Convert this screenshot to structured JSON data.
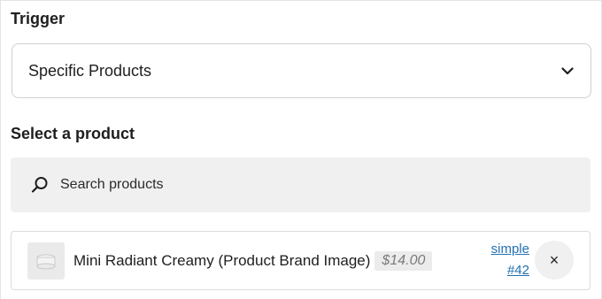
{
  "trigger": {
    "label": "Trigger",
    "selected": "Specific Products"
  },
  "product_select": {
    "label": "Select a product",
    "search_placeholder": "Search products"
  },
  "selected_product": {
    "name": "Mini Radiant Creamy (Product Brand Image)",
    "price": "$14.00",
    "type": "simple",
    "id": "#42",
    "remove_label": "×"
  },
  "icons": {
    "chevron": "chevron-down-icon",
    "search": "search-icon",
    "thumbnail": "product-thumbnail-icon"
  },
  "colors": {
    "link": "#2271b1",
    "search_bg": "#f0f0f0",
    "badge_bg": "#ececec"
  }
}
